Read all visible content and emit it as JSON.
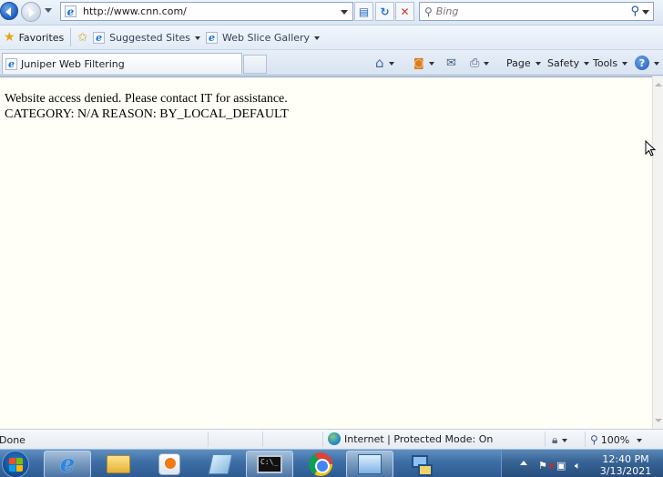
{
  "address_bar": {
    "url": "http://www.cnn.com/",
    "search_placeholder": "Bing"
  },
  "favorites_bar": {
    "favorites_label": "Favorites",
    "links": [
      {
        "label": "Suggested Sites"
      },
      {
        "label": "Web Slice Gallery"
      }
    ]
  },
  "tab": {
    "title": "Juniper Web Filtering"
  },
  "command_bar": {
    "page_label": "Page",
    "safety_label": "Safety",
    "tools_label": "Tools",
    "help_label": "?"
  },
  "content": {
    "line1": "Website access denied. Please contact IT for assistance.",
    "line2": "CATEGORY: N/A REASON: BY_LOCAL_DEFAULT"
  },
  "status_bar": {
    "status_text": "Done",
    "zone_text": "Internet | Protected Mode: On",
    "zoom": "100%"
  },
  "taskbar": {
    "time": "12:40 PM",
    "date": "3/13/2021"
  },
  "icons": {
    "back": "back-arrow-icon",
    "forward": "forward-arrow-icon",
    "refresh": "refresh-icon",
    "stop": "stop-icon",
    "search": "search-icon",
    "home": "home-icon",
    "feeds": "rss-feed-icon",
    "mail": "mail-icon",
    "print": "print-icon",
    "help": "help-icon"
  }
}
